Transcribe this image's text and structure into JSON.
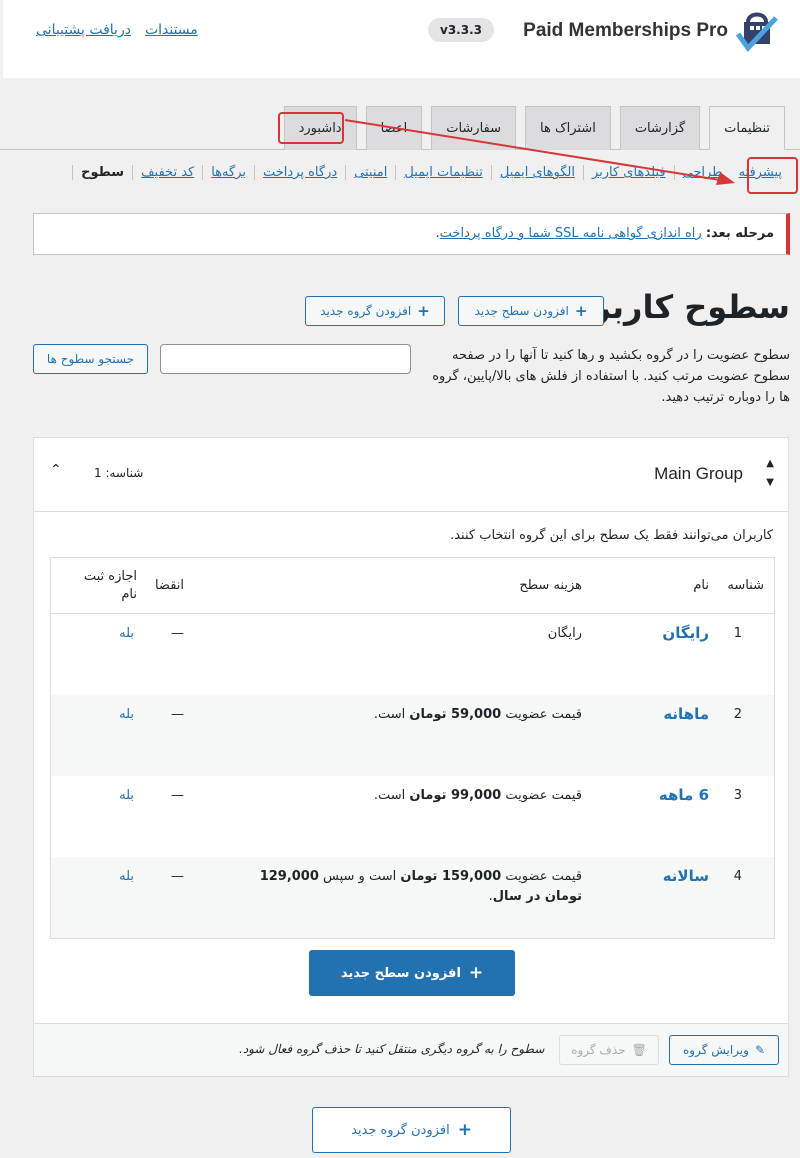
{
  "header": {
    "logo_text": "Paid Memberships Pro",
    "version": "v3.3.3",
    "links": [
      "مستندات",
      "دریافت پشتیبانی"
    ]
  },
  "tabs": [
    "داشبورد",
    "اعضا",
    "سفارشات",
    "اشتراک ها",
    "گزارشات",
    "تنظیمات"
  ],
  "subnav": [
    "سطوح",
    "کد تخفیف",
    "برگه‌ها",
    "درگاه پرداخت",
    "امنیتی",
    "تنظیمات ایمیل",
    "الگوهای ایمیل",
    "فیلدهای کاربر",
    "طراحی",
    "پیشرفته"
  ],
  "notice": {
    "label": "مرحله بعد:",
    "link": "راه اندازی گواهی نامه SSL شما و درگاه پرداخت",
    "end": "."
  },
  "page": {
    "title": "سطوح کاربری",
    "add_level_btn": "افزودن سطح جدید",
    "add_group_btn": "افزودن گروه جدید",
    "description": "سطوح عضویت را در گروه بکشید و رها کنید تا آنها را در صفحه سطوح عضویت مرتب کنید. با استفاده از فلش های بالا/پایین، گروه ها را دوباره ترتیب دهید.",
    "search_btn": "جستجو سطوح ها"
  },
  "group": {
    "name": "Main Group",
    "id_label": "شناسه: 1",
    "note": "کاربران می‌توانند فقط یک سطح برای این گروه انتخاب کنند.",
    "columns": [
      "شناسه",
      "نام",
      "هزینه سطح",
      "انقضا",
      "اجازه ثبت نام"
    ],
    "rows": [
      {
        "id": "1",
        "name": "رایگان",
        "cost_pre": "رایگان",
        "cost_b1": "",
        "cost_mid": "",
        "cost_b2": "",
        "cost_end": "",
        "expire": "—",
        "signup": "بله"
      },
      {
        "id": "2",
        "name": "ماهانه",
        "cost_pre": "قیمت عضویت ",
        "cost_b1": "59,000 تومان",
        "cost_mid": " است.",
        "cost_b2": "",
        "cost_end": "",
        "expire": "—",
        "signup": "بله"
      },
      {
        "id": "3",
        "name": "6 ماهه",
        "cost_pre": "قیمت عضویت ",
        "cost_b1": "99,000 تومان",
        "cost_mid": " است.",
        "cost_b2": "",
        "cost_end": "",
        "expire": "—",
        "signup": "بله"
      },
      {
        "id": "4",
        "name": "سالانه",
        "cost_pre": "قیمت عضویت ",
        "cost_b1": "159,000 تومان",
        "cost_mid": " است و سپس ",
        "cost_b2": "129,000 تومان در سال",
        "cost_end": ".",
        "expire": "—",
        "signup": "بله"
      }
    ],
    "add_level_btn": "افزودن سطح جدید",
    "edit_btn": "ویرایش گروه",
    "delete_btn": "حذف گروه",
    "foot_note": "سطوح را به گروه دیگری منتقل کنید تا حذف گروه فعال شود."
  },
  "bottom_add_group_btn": "افزودن گروه جدید",
  "colors": {
    "accent": "#2271b1",
    "highlight": "#d63638"
  }
}
